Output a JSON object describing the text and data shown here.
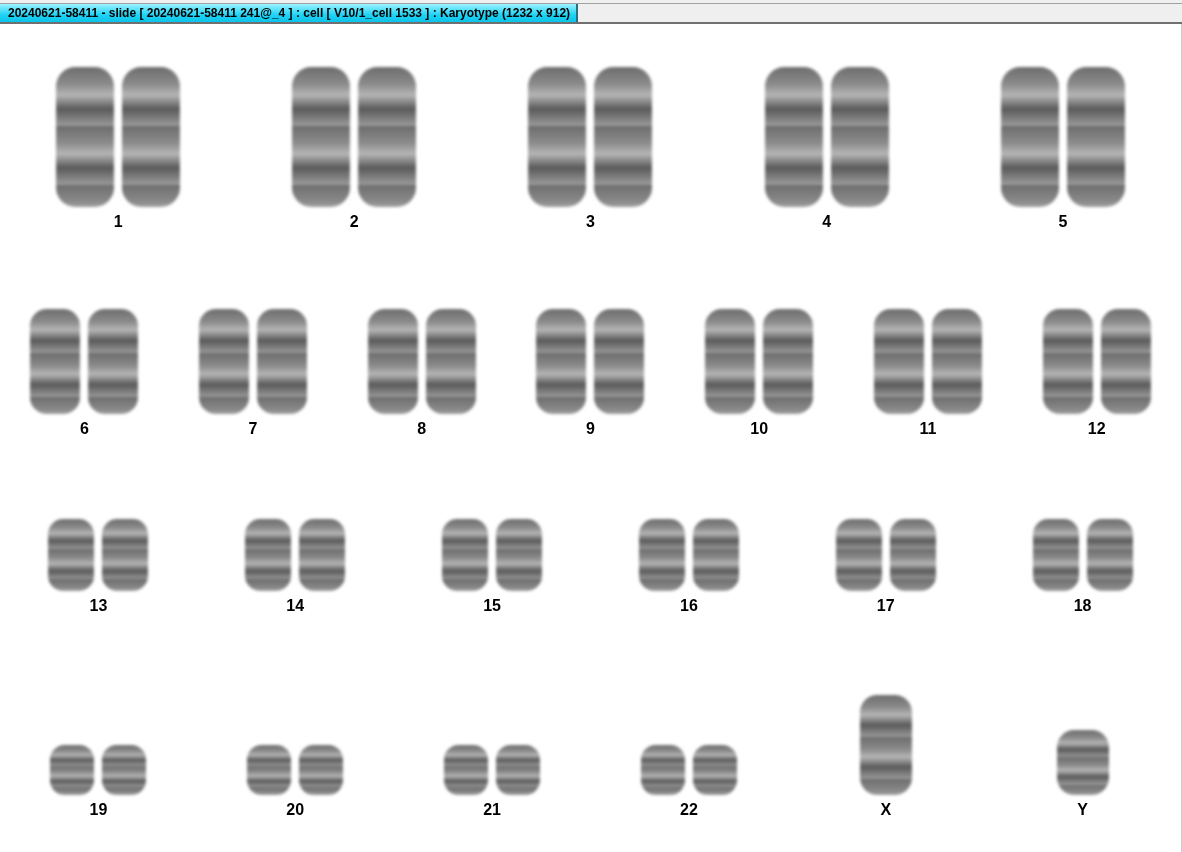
{
  "window": {
    "title": "20240621-58411 - slide [ 20240621-58411 241@_4 ] : cell [ V10/1_cell 1533 ] : Karyotype  (1232 x 912)"
  },
  "karyotype": {
    "rows": [
      {
        "items": [
          {
            "label": "1",
            "kind": "pair"
          },
          {
            "label": "2",
            "kind": "pair"
          },
          {
            "label": "3",
            "kind": "pair"
          },
          {
            "label": "4",
            "kind": "pair"
          },
          {
            "label": "5",
            "kind": "pair"
          }
        ]
      },
      {
        "items": [
          {
            "label": "6",
            "kind": "pair"
          },
          {
            "label": "7",
            "kind": "pair"
          },
          {
            "label": "8",
            "kind": "pair"
          },
          {
            "label": "9",
            "kind": "pair"
          },
          {
            "label": "10",
            "kind": "pair"
          },
          {
            "label": "11",
            "kind": "pair"
          },
          {
            "label": "12",
            "kind": "pair"
          }
        ]
      },
      {
        "items": [
          {
            "label": "13",
            "kind": "pair"
          },
          {
            "label": "14",
            "kind": "pair"
          },
          {
            "label": "15",
            "kind": "pair"
          },
          {
            "label": "16",
            "kind": "pair"
          },
          {
            "label": "17",
            "kind": "pair"
          },
          {
            "label": "18",
            "kind": "pair"
          }
        ]
      },
      {
        "items": [
          {
            "label": "19",
            "kind": "pair"
          },
          {
            "label": "20",
            "kind": "pair"
          },
          {
            "label": "21",
            "kind": "pair"
          },
          {
            "label": "22",
            "kind": "pair"
          },
          {
            "label": "X",
            "kind": "single"
          },
          {
            "label": "Y",
            "kind": "single"
          }
        ]
      }
    ]
  }
}
